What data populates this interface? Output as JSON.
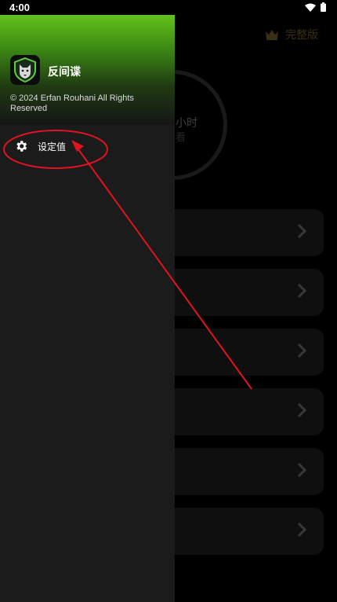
{
  "status_bar": {
    "time": "4:00"
  },
  "background": {
    "premium_label": "完整版",
    "timer_text": "小时",
    "timer_sub": "看",
    "list_items": 6
  },
  "drawer": {
    "app_name": "反间谍",
    "copyright": "© 2024 Erfan Rouhani All Rights Reserved",
    "menu": [
      {
        "label": "设定值",
        "icon": "gear-icon"
      }
    ]
  },
  "annotation": {
    "color": "#e0141e",
    "shapes": [
      "ellipse-highlight",
      "arrow"
    ]
  },
  "colors": {
    "drawer_header_green": "#63c21b",
    "premium_gold": "#7a6a2a",
    "annotation_red": "#e0141e"
  }
}
